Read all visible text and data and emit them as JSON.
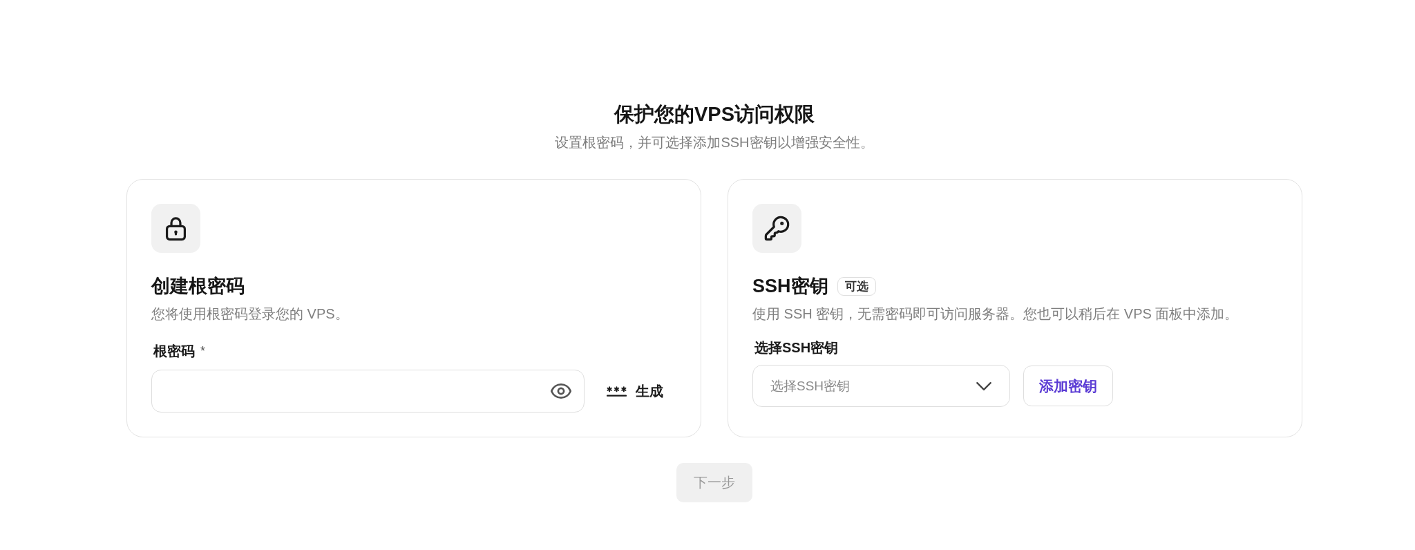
{
  "header": {
    "title": "保护您的VPS访问权限",
    "subtitle": "设置根密码，并可选择添加SSH密钥以增强安全性。"
  },
  "cards": [
    {
      "kind": "root_password",
      "title": "创建根密码",
      "description": "您将使用根密码登录您的 VPS。",
      "field": {
        "label": "根密码",
        "required_mark": "*"
      },
      "button": {
        "label": "生成"
      }
    },
    {
      "kind": "ssh_key",
      "title": "SSH密钥",
      "badge": "可选",
      "description": "使用 SSH 密钥，无需密码即可访问服务器。您也可以稍后在 VPS 面板中添加。",
      "field": {
        "label": "选择SSH密钥",
        "placeholder": "选择SSH密钥"
      },
      "button": {
        "label": "添加密钥"
      }
    }
  ],
  "next_button": {
    "label": "下一步",
    "disabled": true
  }
}
